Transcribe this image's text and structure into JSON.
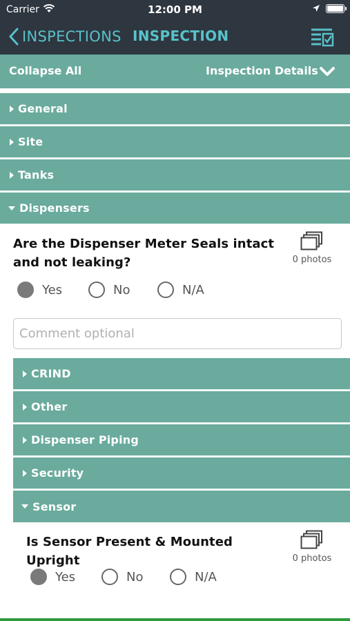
{
  "status_bar": {
    "carrier": "Carrier",
    "time": "12:00 PM"
  },
  "nav": {
    "back_label": "INSPECTIONS",
    "title": "INSPECTION",
    "accent_color": "#58c2c9"
  },
  "toolbar": {
    "collapse_label": "Collapse All",
    "details_label": "Inspection Details"
  },
  "sections": {
    "general": "General",
    "site": "Site",
    "tanks": "Tanks",
    "dispensers": "Dispensers"
  },
  "dispensers": {
    "question": "Are the Dispenser Meter Seals intact and not leaking?",
    "photos": "0 photos",
    "options": [
      "Yes",
      "No",
      "N/A"
    ],
    "selected": "Yes",
    "comment_placeholder": "Comment optional",
    "subsections": {
      "crind": "CRIND",
      "other": "Other",
      "piping": "Dispenser Piping",
      "security": "Security",
      "sensor": "Sensor"
    }
  },
  "sensor": {
    "question": "Is Sensor Present & Mounted Upright",
    "photos": "0 photos",
    "options": [
      "Yes",
      "No",
      "N/A"
    ],
    "selected": "Yes"
  },
  "colors": {
    "header_dark": "#2e3640",
    "section_green": "#6aab9d",
    "bottom_bar": "#2e9a3d"
  }
}
